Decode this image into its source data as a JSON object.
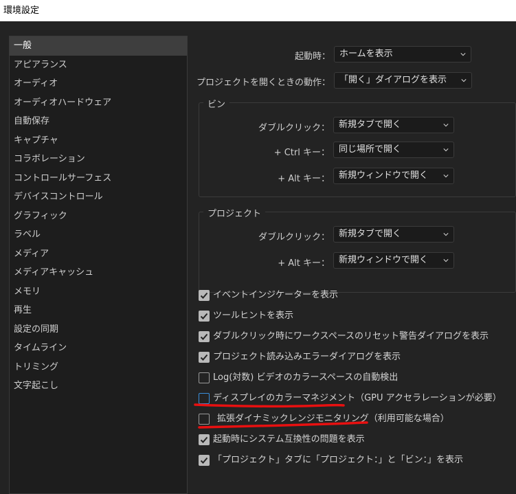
{
  "window": {
    "title": "環境設定"
  },
  "sidebar": {
    "items": [
      {
        "label": "一般",
        "selected": true
      },
      {
        "label": "アピアランス"
      },
      {
        "label": "オーディオ"
      },
      {
        "label": "オーディオハードウェア"
      },
      {
        "label": "自動保存"
      },
      {
        "label": "キャプチャ"
      },
      {
        "label": "コラボレーション"
      },
      {
        "label": "コントロールサーフェス"
      },
      {
        "label": "デバイスコントロール"
      },
      {
        "label": "グラフィック"
      },
      {
        "label": "ラベル"
      },
      {
        "label": "メディア"
      },
      {
        "label": "メディアキャッシュ"
      },
      {
        "label": "メモリ"
      },
      {
        "label": "再生"
      },
      {
        "label": "設定の同期"
      },
      {
        "label": "タイムライン"
      },
      {
        "label": "トリミング"
      },
      {
        "label": "文字起こし"
      }
    ]
  },
  "general": {
    "startup_label": "起動時：",
    "startup_value": "ホームを表示",
    "open_project_label": "プロジェクトを開くときの動作：",
    "open_project_value": "「開く」ダイアログを表示"
  },
  "bin_group": {
    "title": "ビン",
    "double_click_label": "ダブルクリック：",
    "double_click_value": "新規タブで開く",
    "ctrl_label": "+ Ctrl キー：",
    "ctrl_value": "同じ場所で開く",
    "alt_label": "+ Alt キー：",
    "alt_value": "新規ウィンドウで開く"
  },
  "project_group": {
    "title": "プロジェクト",
    "double_click_label": "ダブルクリック：",
    "double_click_value": "新規タブで開く",
    "alt_label": "+ Alt キー：",
    "alt_value": "新規ウィンドウで開く"
  },
  "checkboxes": [
    {
      "label": "イベントインジケーターを表示",
      "checked": true
    },
    {
      "label": "ツールヒントを表示",
      "checked": true
    },
    {
      "label": "ダブルクリック時にワークスペースのリセット警告ダイアログを表示",
      "checked": true
    },
    {
      "label": "プロジェクト読み込みエラーダイアログを表示",
      "checked": true
    },
    {
      "label": "Log(対数) ビデオのカラースペースの自動検出",
      "checked": false
    },
    {
      "label": "ディスプレイのカラーマネジメント（GPU アクセラレーションが必要）",
      "checked": false,
      "focused": true
    },
    {
      "label": "拡張ダイナミックレンジモニタリング（利用可能な場合）",
      "checked": false
    },
    {
      "label": "起動時にシステム互換性の問題を表示",
      "checked": true
    },
    {
      "label": "「プロジェクト」タブに「プロジェクト：」と「ビン：」を表示",
      "checked": true
    }
  ],
  "colors": {
    "background": "#232323",
    "panel": "#1d1d1d",
    "accent_focus": "#3a8fdc",
    "annotation_underline": "#e81010"
  }
}
